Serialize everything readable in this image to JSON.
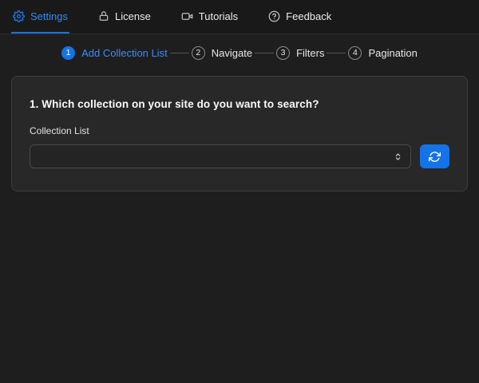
{
  "topbar": {
    "tabs": [
      {
        "label": "Settings",
        "icon": "gear-icon",
        "active": true
      },
      {
        "label": "License",
        "icon": "lock-icon",
        "active": false
      },
      {
        "label": "Tutorials",
        "icon": "video-camera-icon",
        "active": false
      },
      {
        "label": "Feedback",
        "icon": "help-circle-icon",
        "active": false
      }
    ]
  },
  "stepper": {
    "steps": [
      {
        "number": "1",
        "label": "Add Collection List",
        "active": true
      },
      {
        "number": "2",
        "label": "Navigate",
        "active": false
      },
      {
        "number": "3",
        "label": "Filters",
        "active": false
      },
      {
        "number": "4",
        "label": "Pagination",
        "active": false
      }
    ]
  },
  "card": {
    "question": "1. Which collection on your site do you want to search?",
    "field_label": "Collection List",
    "select_value": "",
    "select_chevron_icon": "chevron-up-down-icon",
    "refresh_button_icon": "sync-icon"
  },
  "colors": {
    "accent_blue": "#1473e6",
    "link_blue": "#3d8bfd",
    "page_background": "#1e1e1e",
    "topbar_background": "#191919",
    "card_background": "#282828",
    "card_border": "#3d3d3d"
  }
}
